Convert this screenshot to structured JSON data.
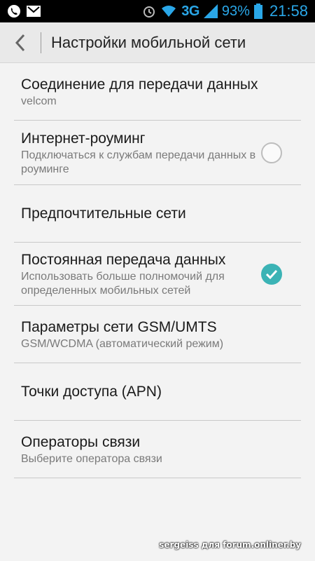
{
  "status_bar": {
    "network_type": "3G",
    "battery_percent": "93%",
    "time": "21:58",
    "icons": [
      "phone-icon",
      "mail-icon",
      "alarm-icon",
      "wifi-icon",
      "signal-icon",
      "battery-icon"
    ],
    "accent_color": "#2aa7e8"
  },
  "header": {
    "title": "Настройки мобильной сети",
    "back_icon": "back-chevron-icon"
  },
  "settings": [
    {
      "title": "Соединение для передачи данных",
      "summary": "velcom"
    },
    {
      "title": "Интернет-роуминг",
      "summary": "Подключаться к службам передачи данных в роуминге",
      "checked": false
    },
    {
      "title": "Предпочтительные сети"
    },
    {
      "title": "Постоянная передача данных",
      "summary": "Использовать больше полномочий для определенных мобильных сетей",
      "checked": true
    },
    {
      "title": "Параметры сети GSM/UMTS",
      "summary": "GSM/WCDMA (автоматический режим)"
    },
    {
      "title": "Точки доступа (APN)"
    },
    {
      "title": "Операторы связи",
      "summary": "Выберите оператора связи"
    }
  ],
  "check_color": "#3bb3b5",
  "watermark": "sergeiss для forum.onliner.by"
}
